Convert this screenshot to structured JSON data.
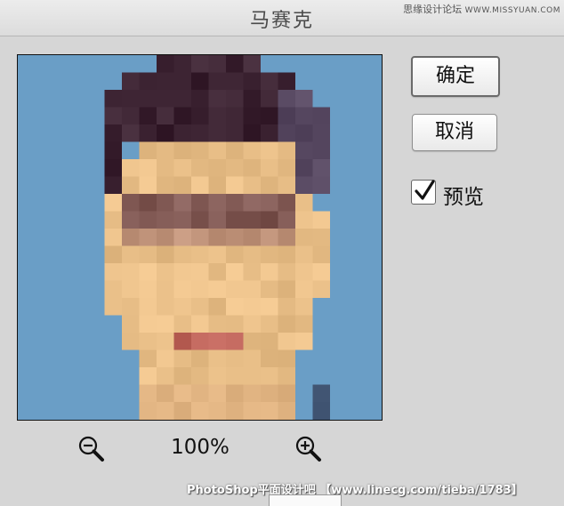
{
  "window": {
    "title": "马赛克",
    "watermark_top_cn": "思缘设计论坛",
    "watermark_top_url": "WWW.MISSYUAN.COM"
  },
  "preview": {
    "image": "pixelated-portrait-face",
    "background_color": "#6a9ec6"
  },
  "buttons": {
    "ok_label": "确定",
    "cancel_label": "取消"
  },
  "preview_toggle": {
    "label": "预览",
    "checked": true
  },
  "zoom": {
    "level": "100%",
    "zoom_out_icon": "zoom-out-icon",
    "zoom_in_icon": "zoom-in-icon"
  },
  "watermark_bottom": "PhotoShop平面设计吧 【www.linecg.com/tieba/1783】"
}
